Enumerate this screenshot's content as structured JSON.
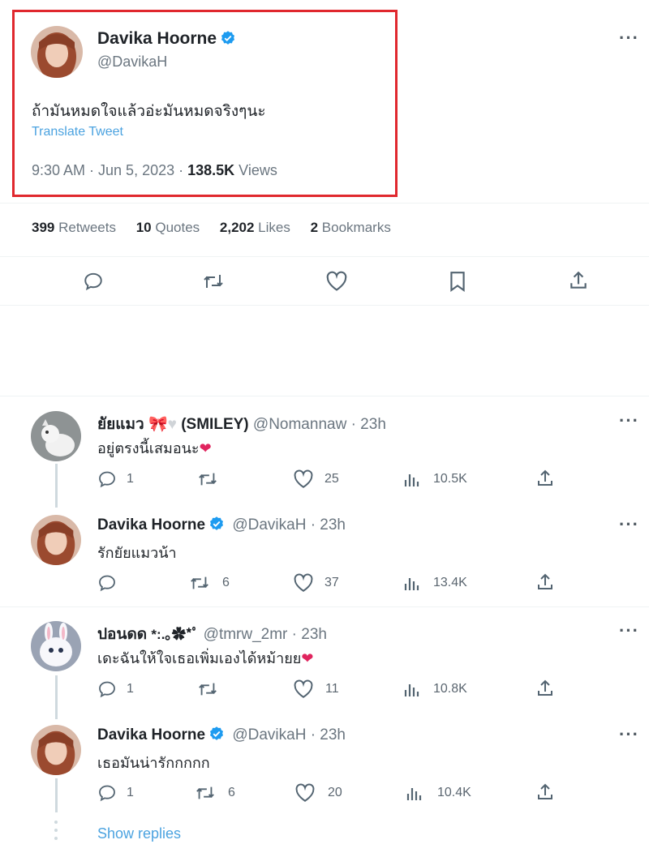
{
  "main_tweet": {
    "author_name": "Davika Hoorne",
    "handle": "@DavikaH",
    "text": "ถ้ามันหมดใจแล้วอ่ะมันหมดจริงๆนะ",
    "translate_label": "Translate Tweet",
    "time": "9:30 AM · Jun 5, 2023 · ",
    "views_count": "138.5K",
    "views_label": " Views",
    "highlight_color": "#e0282e"
  },
  "stats": {
    "retweets_count": "399",
    "retweets_label": " Retweets",
    "quotes_count": "10",
    "quotes_label": " Quotes",
    "likes_count": "2,202",
    "likes_label": " Likes",
    "bookmarks_count": "2",
    "bookmarks_label": " Bookmarks"
  },
  "replies": [
    {
      "name": "ยัยแมว",
      "name_suffix": "(SMILEY)",
      "handle_time": "@Nomannaw · 23h",
      "text": "อยู่ตรงนี้เสมอนะ",
      "reply_count": "1",
      "retweet_count": "",
      "like_count": "25",
      "view_count": "10.5K",
      "verified": false
    },
    {
      "name": "Davika Hoorne",
      "handle_time": "@DavikaH · 23h",
      "text": "รักยัยแมวน้า",
      "reply_count": "",
      "retweet_count": "6",
      "like_count": "37",
      "view_count": "13.4K",
      "verified": true
    },
    {
      "name": "ปอนดด",
      "name_suffix": "*:.｡✿*ﾟ",
      "handle_time": "@tmrw_2mr · 23h",
      "text": "เดะฉันให้ใจเธอเพิ่มเองได้หม้ายย",
      "reply_count": "1",
      "retweet_count": "",
      "like_count": "11",
      "view_count": "10.8K",
      "verified": false
    },
    {
      "name": "Davika Hoorne",
      "handle_time": "@DavikaH · 23h",
      "text": "เธอมันน่ารักกกกก",
      "reply_count": "1",
      "retweet_count": "6",
      "like_count": "20",
      "view_count": "10.4K",
      "verified": true
    }
  ],
  "show_replies_label": "Show replies",
  "colors": {
    "accent": "#1d9bf0",
    "heart_emoji": "#e0245e"
  }
}
